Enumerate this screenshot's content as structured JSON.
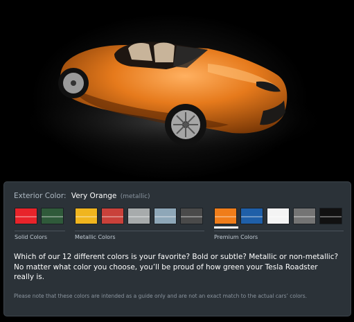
{
  "exterior": {
    "label": "Exterior Color:",
    "value": "Very Orange",
    "finish": "(metallic)"
  },
  "groups": [
    {
      "label": "Solid Colors"
    },
    {
      "label": "Metallic Colors"
    },
    {
      "label": "Premium Colors"
    }
  ],
  "swatch_colors": [
    "#e8232a",
    "#2f5a3a",
    "#f0b51e",
    "#c9413a",
    "#a7abac",
    "#8ea7b8",
    "#4a4a4a",
    "#f07d1a",
    "#1f5fa8",
    "#f4f4f4",
    "#747474",
    "#111111"
  ],
  "description": "Which of our 12 different colors is your favorite? Bold or subtle? Metallic or non-metallic? No matter what color you choose, you’ll be proud of how green your Tesla Roadster really is.",
  "note": "Please note that these colors are intended as a guide only and are not an exact match to the actual cars’ colors.",
  "selected_color": "Very Orange"
}
